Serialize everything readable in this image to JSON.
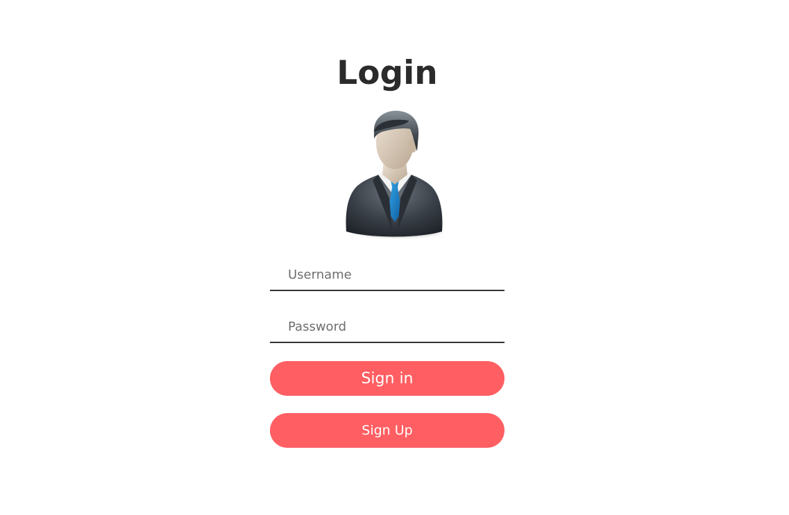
{
  "page": {
    "title": "Login"
  },
  "avatar": {
    "icon": "business-user-icon"
  },
  "form": {
    "username_placeholder": "Username",
    "password_placeholder": "Password",
    "signin_label": "Sign in",
    "signup_label": "Sign Up"
  },
  "colors": {
    "accent": "#ff5e62",
    "text": "#2b2b2b",
    "underline": "#333333"
  }
}
